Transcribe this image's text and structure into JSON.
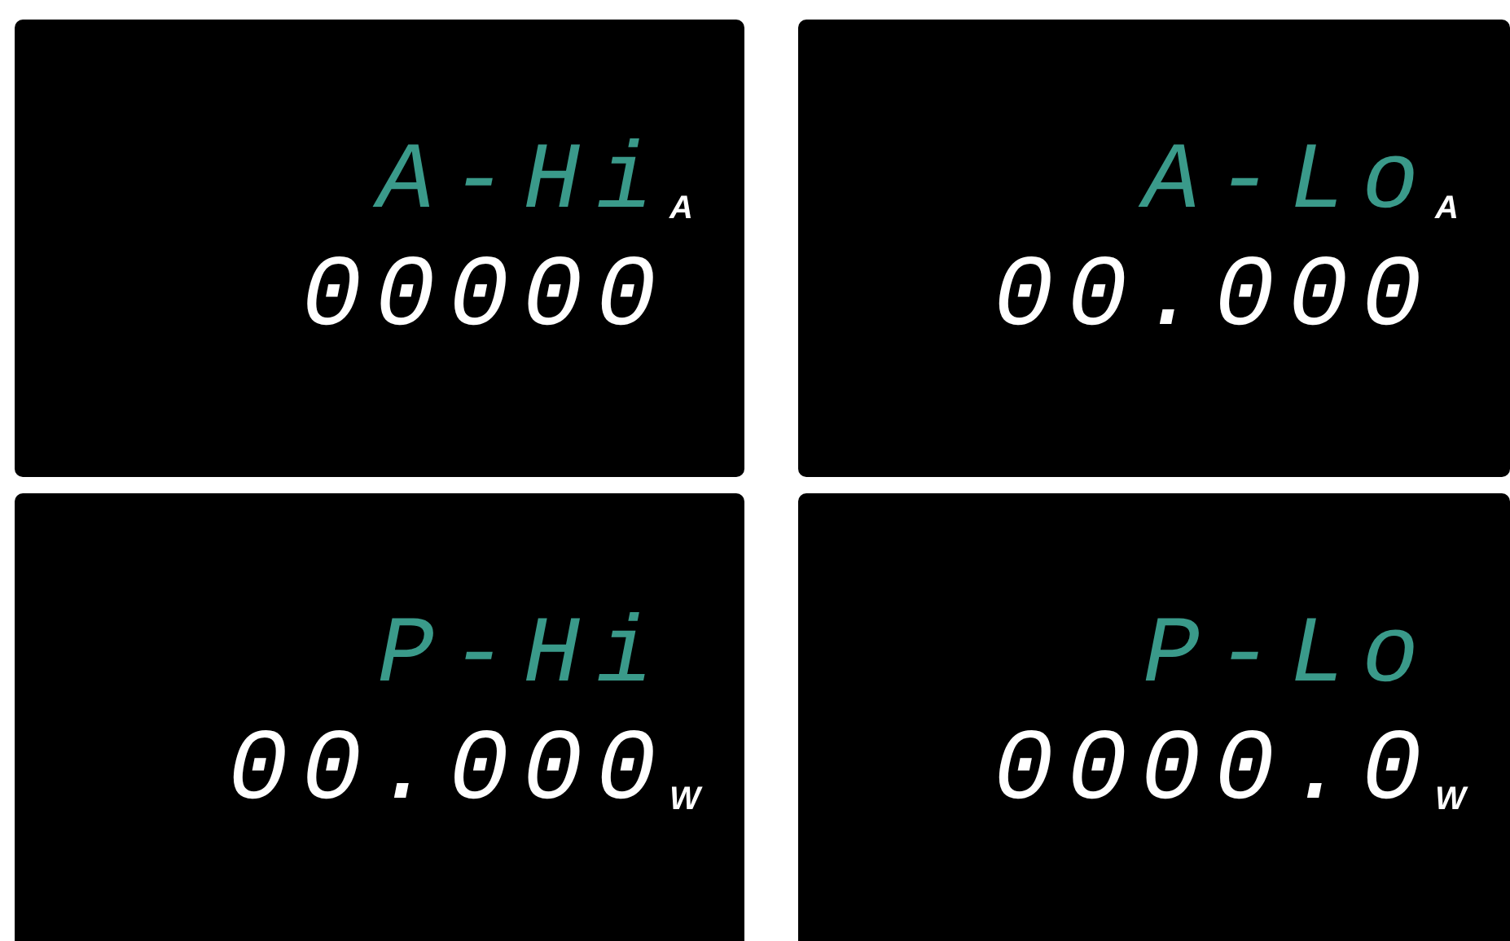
{
  "panels": [
    {
      "kind": "current",
      "label": "A-Hi",
      "value": "00000",
      "unit": "A"
    },
    {
      "kind": "current",
      "label": "A-Lo",
      "value": "00.000",
      "unit": "A"
    },
    {
      "kind": "power",
      "label": "P-Hi",
      "value": "00.000",
      "unit": "W"
    },
    {
      "kind": "power",
      "label": "P-Lo",
      "value": "0000.0",
      "unit": "W"
    }
  ]
}
